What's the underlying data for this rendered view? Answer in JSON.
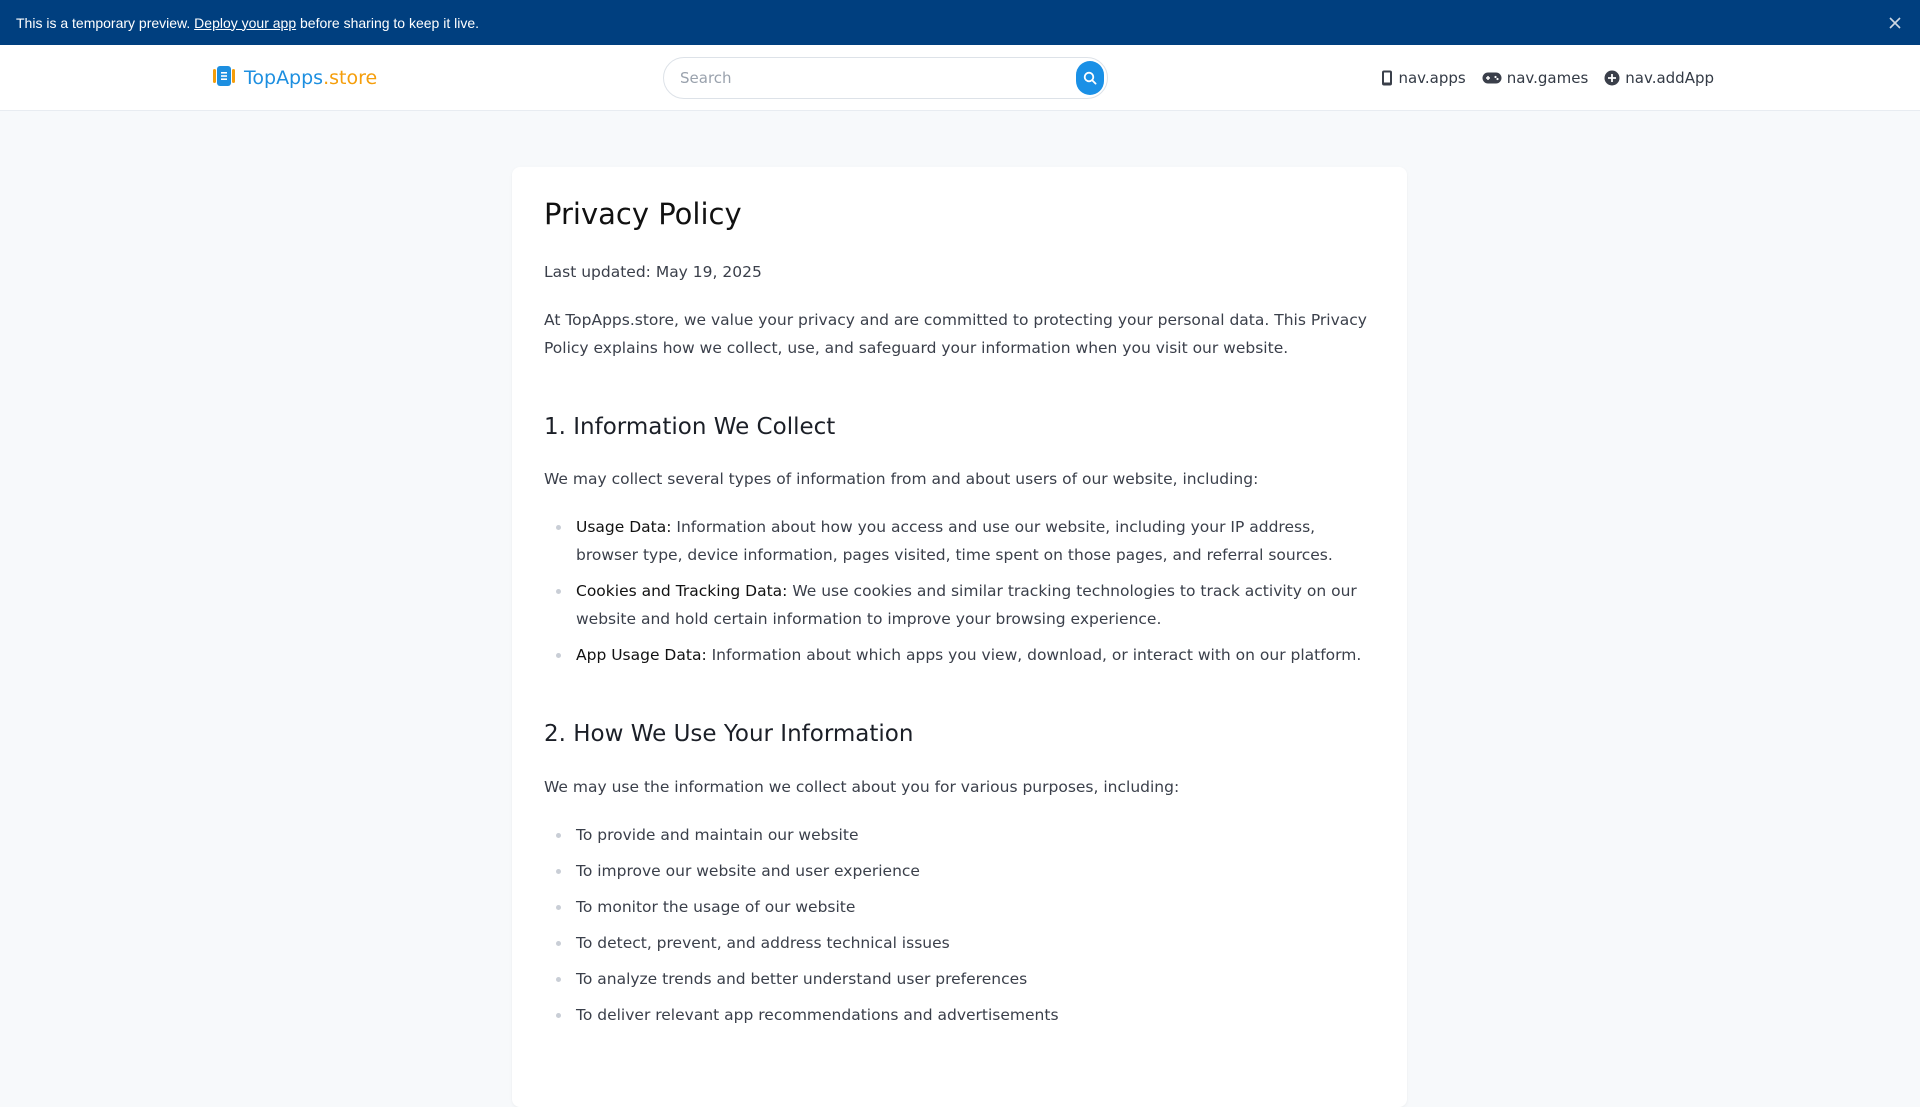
{
  "banner": {
    "text_before": "This is a temporary preview. ",
    "link": "Deploy your app",
    "text_after": " before sharing to keep it live."
  },
  "header": {
    "logo_brand": "TopApps",
    "logo_tld": ".store",
    "search_placeholder": "Search",
    "nav": [
      "nav.apps",
      "nav.games",
      "nav.addApp"
    ]
  },
  "content": {
    "title": "Privacy Policy",
    "last_updated": "Last updated: May 19, 2025",
    "intro": "At TopApps.store, we value your privacy and are committed to protecting your personal data. This Privacy Policy explains how we collect, use, and safeguard your information when you visit our website.",
    "section1": {
      "heading": "1. Information We Collect",
      "lead": "We may collect several types of information from and about users of our website, including:",
      "items": [
        {
          "term": "Usage Data:",
          "text": " Information about how you access and use our website, including your IP address, browser type, device information, pages visited, time spent on those pages, and referral sources."
        },
        {
          "term": "Cookies and Tracking Data:",
          "text": " We use cookies and similar tracking technologies to track activity on our website and hold certain information to improve your browsing experience."
        },
        {
          "term": "App Usage Data:",
          "text": " Information about which apps you view, download, or interact with on our platform."
        }
      ]
    },
    "section2": {
      "heading": "2. How We Use Your Information",
      "lead": "We may use the information we collect about you for various purposes, including:",
      "items": [
        "To provide and maintain our website",
        "To improve our website and user experience",
        "To monitor the usage of our website",
        "To detect, prevent, and address technical issues",
        "To analyze trends and better understand user preferences",
        "To deliver relevant app recommendations and advertisements"
      ]
    }
  },
  "colors": {
    "banner_bg": "#003f7f",
    "brand_blue": "#1d8fe0",
    "brand_orange": "#f59e0b",
    "page_bg": "#f7f9fb"
  },
  "icons": [
    "close-icon",
    "logo-icon",
    "search-icon",
    "phone-icon",
    "gamepad-icon",
    "plus-circle-icon"
  ]
}
